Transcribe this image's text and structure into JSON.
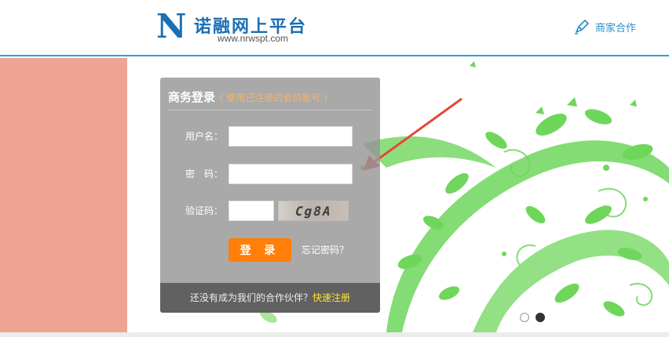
{
  "header": {
    "logo_letter": "N",
    "site_name": "诺融网上平台",
    "site_url": "www.nrwspt.com",
    "merchant_link": "商家合作",
    "accent_color": "#1b6fb3"
  },
  "login": {
    "title": "商务登录",
    "hint": "( 使用已注册的会员账号 )",
    "username_label": "用户名：",
    "password_label": "密　码：",
    "captcha_label": "验证码：",
    "username_value": "",
    "password_value": "",
    "captcha_value": "",
    "captcha_text": "Cg8A",
    "submit_label": "登 录",
    "forgot_label": "忘记密码？",
    "footer_text": "还没有成为我们的合作伙伴？",
    "register_label": "快速注册",
    "button_color": "#ff7f0a"
  },
  "slider": {
    "active_index": 2,
    "count": 2
  },
  "colors": {
    "left_panel": "#efa393",
    "header_border": "#2aa3d8",
    "foliage": "#6fd65c",
    "annotation_arrow": "#e8443a"
  }
}
